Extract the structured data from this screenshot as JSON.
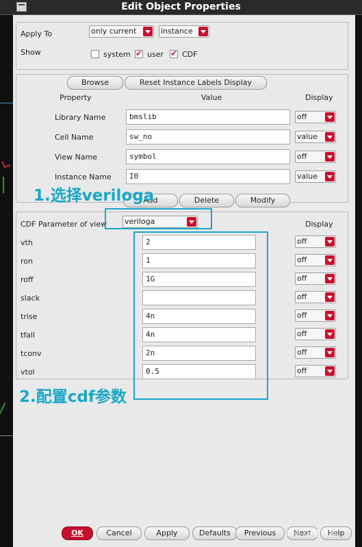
{
  "window": {
    "title": "Edit Object Properties"
  },
  "apply_to": {
    "label": "Apply To",
    "scope_value": "only current",
    "type_value": "instance"
  },
  "show": {
    "label": "Show",
    "options": [
      {
        "label": "system",
        "checked": false
      },
      {
        "label": "user",
        "checked": true
      },
      {
        "label": "CDF",
        "checked": true
      }
    ]
  },
  "props": {
    "browse_label": "Browse",
    "reset_label": "Reset Instance Labels Display",
    "col_property": "Property",
    "col_value": "Value",
    "col_display": "Display",
    "rows": [
      {
        "name": "Library Name",
        "value": "bmslib",
        "display": "off"
      },
      {
        "name": "Cell Name",
        "value": "sw_no",
        "display": "value"
      },
      {
        "name": "View Name",
        "value": "symbol",
        "display": "off"
      },
      {
        "name": "Instance Name",
        "value": "I0",
        "display": "value"
      }
    ]
  },
  "actions": {
    "add_label": "Add",
    "delete_label": "Delete",
    "modify_label": "Modify"
  },
  "cdf": {
    "label": "CDF Parameter of view",
    "view_value": "veriloga",
    "col_display": "Display",
    "params": [
      {
        "name": "vth",
        "value": "2",
        "display": "off"
      },
      {
        "name": "ron",
        "value": "1",
        "display": "off"
      },
      {
        "name": "roff",
        "value": "1G",
        "display": "off"
      },
      {
        "name": "slack",
        "value": "",
        "display": "off"
      },
      {
        "name": "trise",
        "value": "4n",
        "display": "off"
      },
      {
        "name": "tfall",
        "value": "4n",
        "display": "off"
      },
      {
        "name": "tconv",
        "value": "2n",
        "display": "off"
      },
      {
        "name": "vtol",
        "value": "0.5",
        "display": "off"
      }
    ]
  },
  "annotations": {
    "step1": "1.选择veriloga",
    "step2": "2.配置cdf参数",
    "color": "#19a7c9"
  },
  "footer": {
    "ok": "OK",
    "cancel": "Cancel",
    "apply": "Apply",
    "defaults": "Defaults",
    "previous": "Previous",
    "next": "Next",
    "help": "Help"
  },
  "watermark": "知乎 @曹曈原",
  "colors": {
    "accent": "#c8102e",
    "annotation": "#19a7c9"
  }
}
